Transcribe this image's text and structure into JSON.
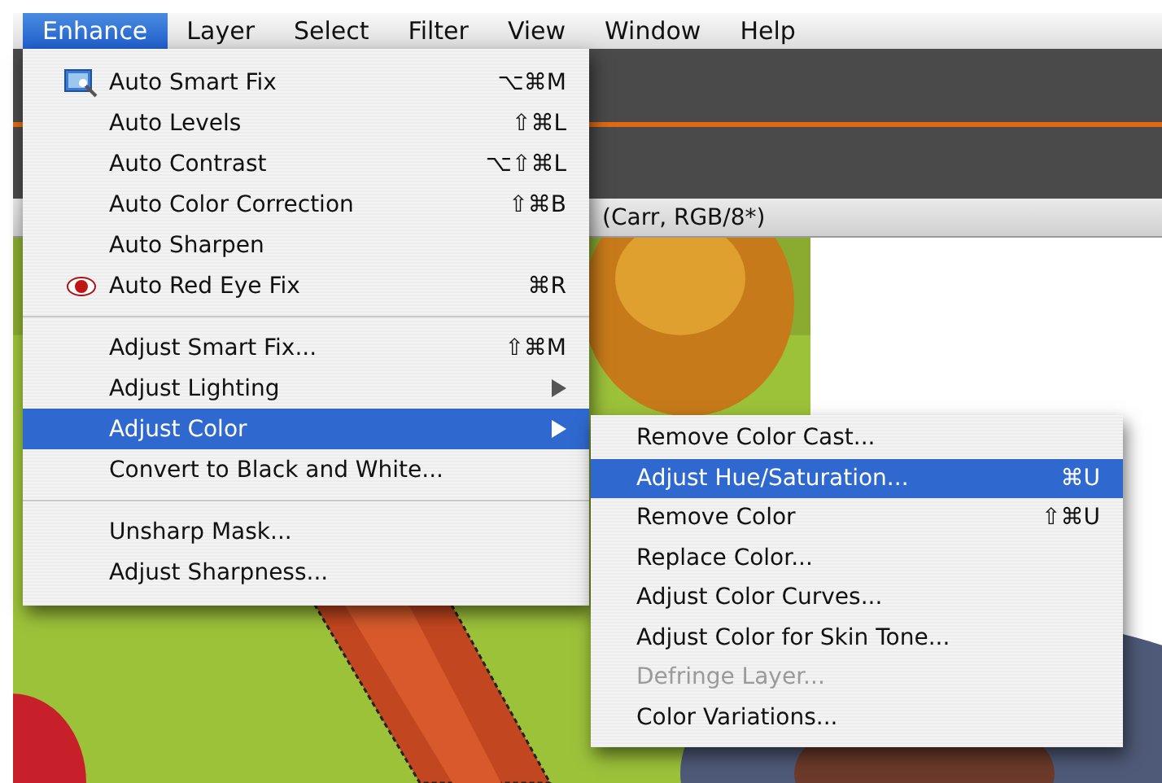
{
  "menu_bar": [
    {
      "label": "Enhance",
      "selected": true
    },
    {
      "label": "Layer",
      "selected": false
    },
    {
      "label": "Select",
      "selected": false
    },
    {
      "label": "Filter",
      "selected": false
    },
    {
      "label": "View",
      "selected": false
    },
    {
      "label": "Window",
      "selected": false
    },
    {
      "label": "Help",
      "selected": false
    }
  ],
  "document": {
    "title": "(Carr, RGB/8*)",
    "kind": "picture"
  },
  "enhance_menu": [
    {
      "kind": "wand",
      "label": "Auto Smart Fix",
      "shortcut": "⌥⌘M",
      "selected": false
    },
    {
      "kind": "item",
      "label": "Auto Levels",
      "shortcut": "⇧⌘L",
      "selected": false
    },
    {
      "kind": "item",
      "label": "Auto Contrast",
      "shortcut": "⌥⇧⌘L",
      "selected": false
    },
    {
      "kind": "item",
      "label": "Auto Color Correction",
      "shortcut": "⇧⌘B",
      "selected": false
    },
    {
      "kind": "item",
      "label": "Auto Sharpen",
      "selected": false
    },
    {
      "kind": "eye",
      "label": "Auto Red Eye Fix",
      "shortcut": "⌘R",
      "selected": false
    },
    {
      "kind": "separator"
    },
    {
      "kind": "item",
      "label": "Adjust Smart Fix...",
      "shortcut": "⇧⌘M",
      "selected": false
    },
    {
      "kind": "submenu",
      "label": "Adjust Lighting",
      "selected": false
    },
    {
      "kind": "submenu",
      "label": "Adjust Color",
      "selected": true
    },
    {
      "kind": "item",
      "label": "Convert to Black and White...",
      "selected": false
    },
    {
      "kind": "separator"
    },
    {
      "kind": "item",
      "label": "Unsharp Mask...",
      "selected": false
    },
    {
      "kind": "item",
      "label": "Adjust Sharpness...",
      "selected": false
    }
  ],
  "adjust_color_submenu": [
    {
      "label": "Remove Color Cast...",
      "selected": false,
      "disabled": false
    },
    {
      "label": "Adjust Hue/Saturation...",
      "shortcut": "⌘U",
      "selected": true,
      "disabled": false
    },
    {
      "label": "Remove Color",
      "shortcut": "⇧⌘U",
      "selected": false,
      "disabled": false
    },
    {
      "label": "Replace Color...",
      "selected": false,
      "disabled": false
    },
    {
      "label": "Adjust Color Curves...",
      "selected": false,
      "disabled": false
    },
    {
      "label": "Adjust Color for Skin Tone...",
      "selected": false,
      "disabled": false
    },
    {
      "label": "Defringe Layer...",
      "selected": false,
      "disabled": true
    },
    {
      "label": "Color Variations...",
      "selected": false,
      "disabled": false
    }
  ]
}
